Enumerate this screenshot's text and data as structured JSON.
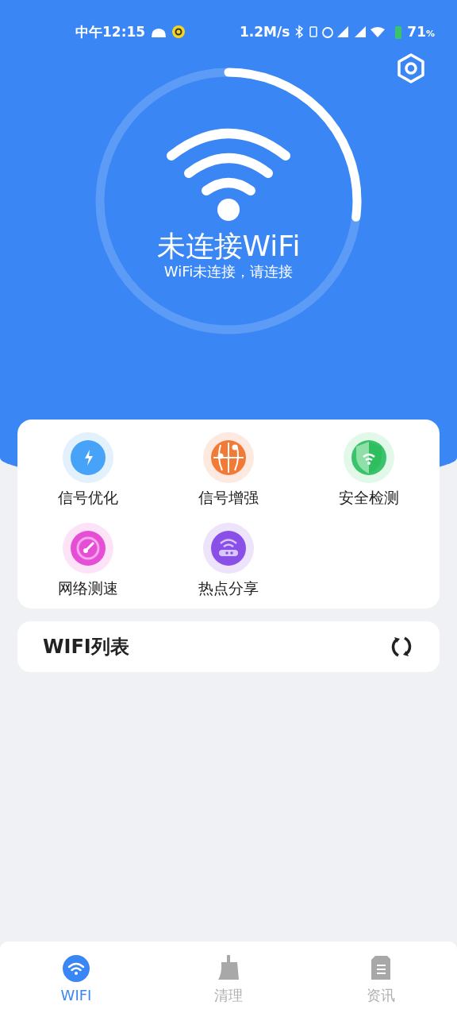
{
  "status_bar": {
    "time": "中午12:15",
    "speed": "1.2M/s",
    "battery": "71",
    "battery_unit": "%"
  },
  "hero": {
    "title": "未连接WiFi",
    "subtitle": "WiFi未连接，请连接",
    "level": 0.27
  },
  "tools": [
    {
      "kind": "optimize",
      "label": "信号优化"
    },
    {
      "kind": "globe",
      "label": "信号增强"
    },
    {
      "kind": "shield",
      "label": "安全检测"
    },
    {
      "kind": "speed",
      "label": "网络测速"
    },
    {
      "kind": "hotspot",
      "label": "热点分享"
    }
  ],
  "wifi_list": {
    "title": "WIFI列表"
  },
  "bottom_nav": [
    {
      "kind": "wifi",
      "label": "WIFI",
      "selected": true
    },
    {
      "kind": "clean",
      "label": "清理",
      "selected": false
    },
    {
      "kind": "news",
      "label": "资讯",
      "selected": false
    }
  ]
}
